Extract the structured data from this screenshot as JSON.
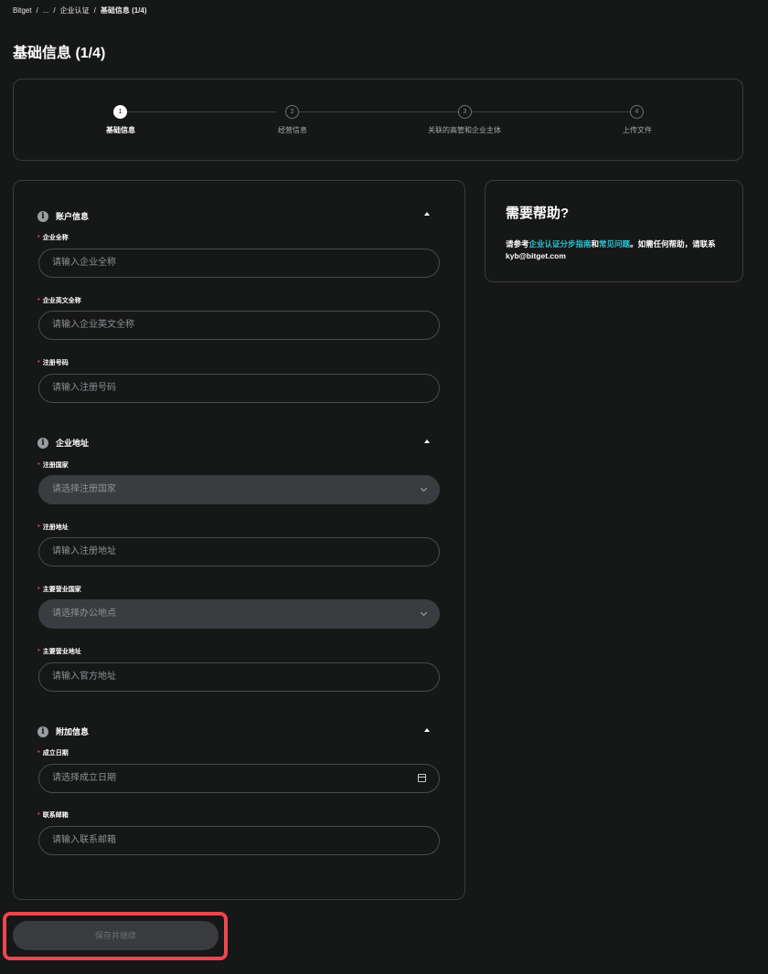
{
  "breadcrumb": {
    "root": "Bitget",
    "sep": "/",
    "ellipsis": "...",
    "parent": "企业认证",
    "current": "基础信息 (1/4)"
  },
  "page_title": "基础信息 (1/4)",
  "stepper": {
    "steps": [
      {
        "num": "1",
        "label": "基础信息",
        "active": true
      },
      {
        "num": "2",
        "label": "经营信息",
        "active": false
      },
      {
        "num": "3",
        "label": "关联的高管和企业主体",
        "active": false
      },
      {
        "num": "4",
        "label": "上传文件",
        "active": false
      }
    ]
  },
  "form": {
    "required_mark": "*",
    "sections": [
      {
        "title": "账户信息",
        "fields": [
          {
            "label": "企业全称",
            "placeholder": "请输入企业全称",
            "type": "text"
          },
          {
            "label": "企业英文全称",
            "placeholder": "请输入企业英文全称",
            "type": "text"
          },
          {
            "label": "注册号码",
            "placeholder": "请输入注册号码",
            "type": "text"
          }
        ]
      },
      {
        "title": "企业地址",
        "fields": [
          {
            "label": "注册国家",
            "placeholder": "请选择注册国家",
            "type": "select"
          },
          {
            "label": "注册地址",
            "placeholder": "请输入注册地址",
            "type": "text"
          },
          {
            "label": "主要营业国家",
            "placeholder": "请选择办公地点",
            "type": "select"
          },
          {
            "label": "主要营业地址",
            "placeholder": "请输入官方地址",
            "type": "text"
          }
        ]
      },
      {
        "title": "附加信息",
        "fields": [
          {
            "label": "成立日期",
            "placeholder": "请选择成立日期",
            "type": "date"
          },
          {
            "label": "联系邮箱",
            "placeholder": "请输入联系邮箱",
            "type": "text"
          }
        ]
      }
    ],
    "submit_label": "保存并继续"
  },
  "help": {
    "title": "需要帮助?",
    "text_prefix": "请参考",
    "link_guide": "企业认证分步指南",
    "text_and": "和",
    "link_faq": "常见问题",
    "text_suffix": "。如需任何帮助，请联系 kyb@bitget.com"
  },
  "colors": {
    "background": "#161717",
    "accent_link": "#2dc4d4",
    "required": "#f23a4e",
    "highlight_border": "#ec4550"
  }
}
